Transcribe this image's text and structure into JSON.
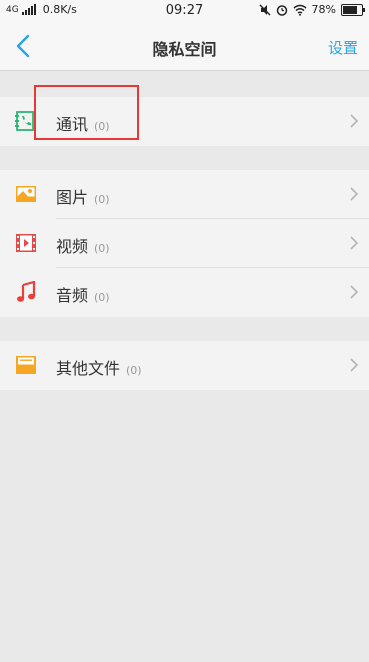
{
  "status_bar": {
    "network": "4G",
    "speed": "0.8K/s",
    "time": "09:27",
    "battery_level": 0.78,
    "battery_text": "78%"
  },
  "nav": {
    "title": "隐私空间",
    "right_action": "设置"
  },
  "items": [
    {
      "label": "通讯",
      "count": "(0)",
      "icon": "contacts-icon"
    },
    {
      "label": "图片",
      "count": "(0)",
      "icon": "image-icon"
    },
    {
      "label": "视频",
      "count": "(0)",
      "icon": "video-icon"
    },
    {
      "label": "音频",
      "count": "(0)",
      "icon": "music-icon"
    },
    {
      "label": "其他文件",
      "count": "(0)",
      "icon": "folder-icon"
    }
  ],
  "colors": {
    "accent": "#2aa3e6",
    "contacts": "#2bb673",
    "image": "#f5a623",
    "video": "#e34b4b",
    "music": "#e8413b",
    "folder": "#f5a623",
    "highlight": "#e53935"
  }
}
